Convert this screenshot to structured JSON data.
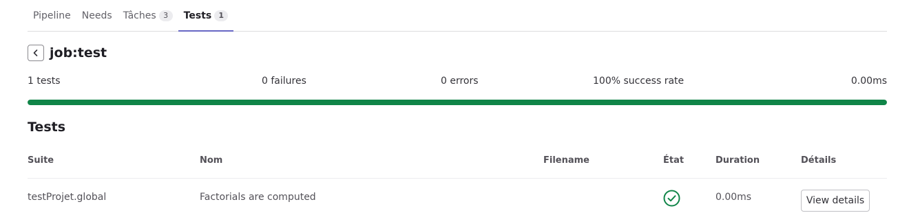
{
  "tabs": [
    {
      "label": "Pipeline",
      "count": null
    },
    {
      "label": "Needs",
      "count": null
    },
    {
      "label": "Tâches",
      "count": "3"
    },
    {
      "label": "Tests",
      "count": "1"
    }
  ],
  "active_tab": "Tests",
  "job": {
    "title": "job:test"
  },
  "summary": {
    "tests": "1 tests",
    "failures": "0 failures",
    "errors": "0 errors",
    "success_rate": "100% success rate",
    "duration": "0.00ms",
    "success_fraction": 1.0
  },
  "colors": {
    "success": "#108548",
    "tab_indicator": "#6666c4"
  },
  "tests_section": {
    "title": "Tests"
  },
  "table": {
    "headers": {
      "suite": "Suite",
      "name": "Nom",
      "filename": "Filename",
      "status": "État",
      "duration": "Duration",
      "details": "Détails"
    },
    "rows": [
      {
        "suite": "testProjet.global",
        "name": "Factorials are computed",
        "filename": "",
        "status_icon": "check-circle-icon",
        "duration": "0.00ms",
        "details_label": "View details"
      }
    ]
  }
}
